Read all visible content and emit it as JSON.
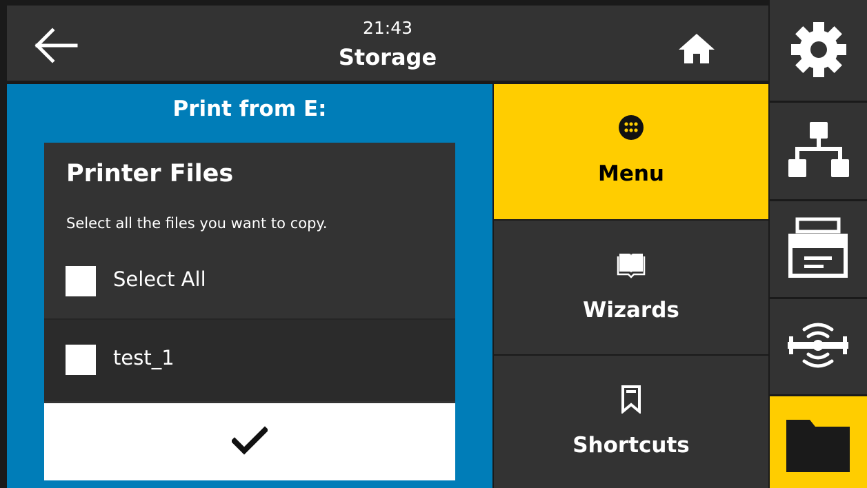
{
  "header": {
    "time": "21:43",
    "title": "Storage"
  },
  "dialog": {
    "title": "Print from E:",
    "panel_title": "Printer Files",
    "description": "Select all the files you want to copy.",
    "select_all_label": "Select All",
    "files": [
      {
        "name": "test_1",
        "checked": false
      }
    ],
    "select_all_checked": false
  },
  "nav": {
    "items": [
      {
        "label": "Menu",
        "icon": "menu-grid-icon",
        "active": true
      },
      {
        "label": "Wizards",
        "icon": "book-icon",
        "active": false
      },
      {
        "label": "Shortcuts",
        "icon": "bookmark-icon",
        "active": false
      }
    ]
  },
  "sidebar": {
    "items": [
      {
        "icon": "gear-icon",
        "active": false
      },
      {
        "icon": "network-icon",
        "active": false
      },
      {
        "icon": "printer-icon",
        "active": false
      },
      {
        "icon": "rfid-icon",
        "active": false
      },
      {
        "icon": "folder-icon",
        "active": true
      }
    ]
  },
  "colors": {
    "accent": "#ffcd00",
    "dialog_blue": "#007db8",
    "panel": "#333333"
  }
}
